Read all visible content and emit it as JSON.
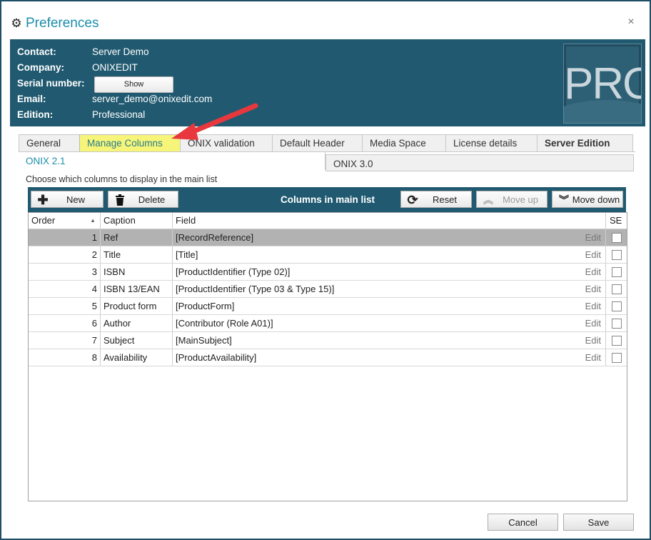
{
  "window": {
    "title": "Preferences",
    "icon": "gear-icon",
    "close_icon": "close-icon",
    "close_glyph": "×"
  },
  "info": {
    "rows": [
      {
        "label": "Contact:",
        "value": "Server Demo"
      },
      {
        "label": "Company:",
        "value": "ONIXEDIT"
      },
      {
        "label": "Serial number:",
        "value": ""
      },
      {
        "label": "Email:",
        "value": "server_demo@onixedit.com"
      },
      {
        "label": "Edition:",
        "value": "Professional"
      }
    ],
    "show_button": "Show",
    "logo_text": "PRO"
  },
  "tabs": [
    "General",
    "Manage Columns",
    "ONIX validation",
    "Default Header",
    "Media Space",
    "License details",
    "Server Edition"
  ],
  "active_tab": "Manage Columns",
  "subtabs": [
    "ONIX 2.1",
    "ONIX 3.0"
  ],
  "active_subtab": "ONIX 2.1",
  "instruction": "Choose which columns to display in the main list",
  "toolbar": {
    "new": "New",
    "delete": "Delete",
    "heading": "Columns in main list",
    "reset": "Reset",
    "move_up": "Move up",
    "move_down": "Move down"
  },
  "grid": {
    "headers": {
      "order": "Order",
      "caption": "Caption",
      "field": "Field",
      "se": "SE"
    },
    "sort_indicator": "▲",
    "edit_label": "Edit",
    "rows": [
      {
        "order": "1",
        "caption": "Ref",
        "field": "[RecordReference]",
        "selected": true
      },
      {
        "order": "2",
        "caption": "Title",
        "field": "[Title]"
      },
      {
        "order": "3",
        "caption": "ISBN",
        "field": "[ProductIdentifier (Type 02)]"
      },
      {
        "order": "4",
        "caption": "ISBN 13/EAN",
        "field": "[ProductIdentifier (Type 03 & Type 15)]"
      },
      {
        "order": "5",
        "caption": "Product form",
        "field": "[ProductForm]"
      },
      {
        "order": "6",
        "caption": "Author",
        "field": "[Contributor (Role A01)]"
      },
      {
        "order": "7",
        "caption": "Subject",
        "field": "[MainSubject]"
      },
      {
        "order": "8",
        "caption": "Availability",
        "field": "[ProductAvailability]"
      }
    ]
  },
  "footer": {
    "cancel": "Cancel",
    "save": "Save"
  },
  "colors": {
    "accent": "#215a70",
    "title": "#1a8eaa",
    "highlight": "#f6f57a",
    "arrow": "#e8383d"
  }
}
